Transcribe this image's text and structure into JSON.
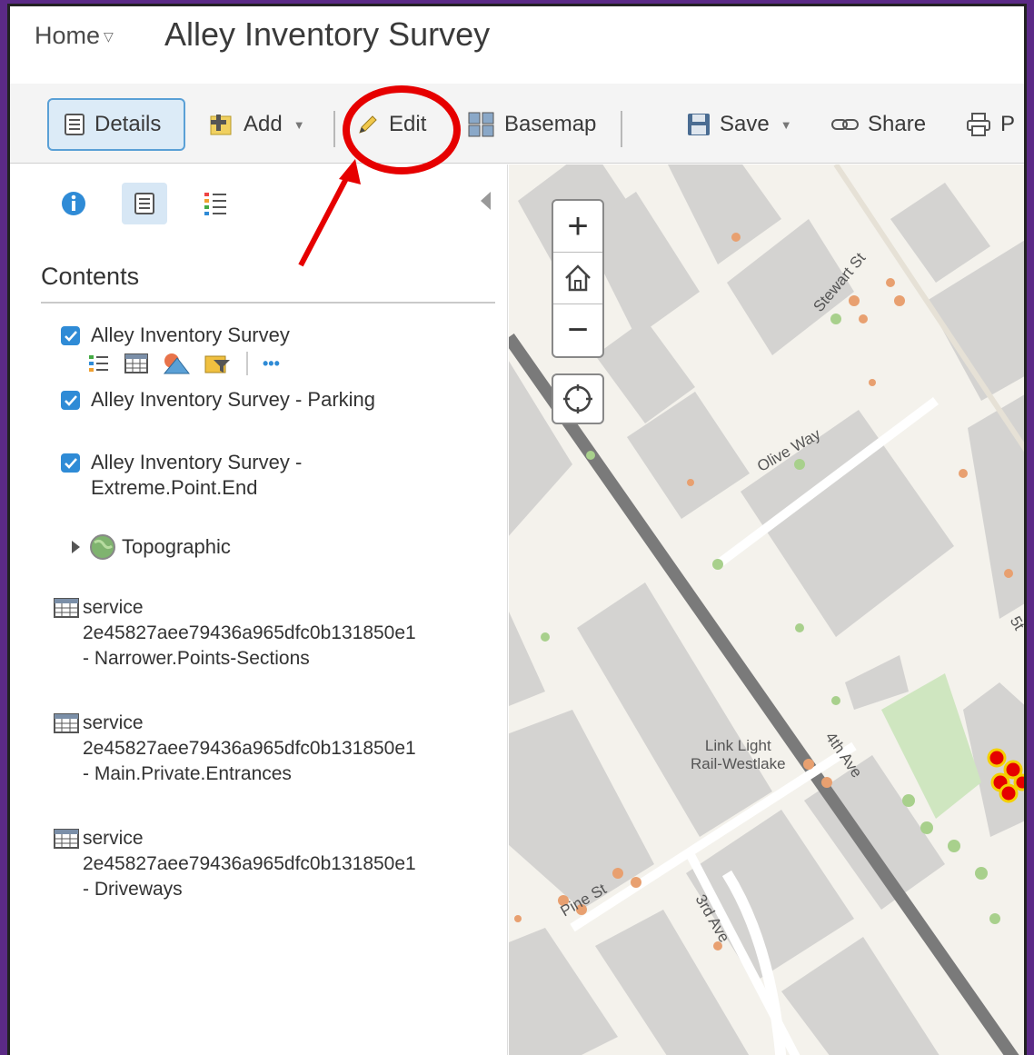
{
  "header": {
    "home_label": "Home",
    "title": "Alley Inventory Survey"
  },
  "toolbar": {
    "details": "Details",
    "add": "Add",
    "edit": "Edit",
    "basemap": "Basemap",
    "save": "Save",
    "share": "Share",
    "print": "P"
  },
  "panel": {
    "heading": "Contents",
    "layers": [
      {
        "label": "Alley Inventory Survey",
        "checked": true
      },
      {
        "label": "Alley Inventory Survey - Parking",
        "checked": true
      },
      {
        "label_line1": "Alley Inventory Survey -",
        "label_line2": "Extreme.Point.End",
        "checked": true
      }
    ],
    "basemap_layer": "Topographic",
    "services": [
      {
        "line1": "service",
        "line2": "2e45827aee79436a965dfc0b131850e1",
        "line3": "- Narrower.Points-Sections"
      },
      {
        "line1": "service",
        "line2": "2e45827aee79436a965dfc0b131850e1",
        "line3": "- Main.Private.Entrances"
      },
      {
        "line1": "service",
        "line2": "2e45827aee79436a965dfc0b131850e1",
        "line3": "- Driveways"
      }
    ],
    "more_label": "•••"
  },
  "map": {
    "streets": {
      "stewart": "Stewart St",
      "olive": "Olive Way",
      "fourth": "4th Ave",
      "pine": "Pine St",
      "third": "3rd Ave",
      "fifth": "5t"
    },
    "station_line1": "Link Light",
    "station_line2": "Rail-Westlake",
    "zoom_in": "+",
    "zoom_out": "−"
  },
  "colors": {
    "accent": "#2f8bd6",
    "annotation": "#e60000",
    "frame": "#5b2a86"
  }
}
